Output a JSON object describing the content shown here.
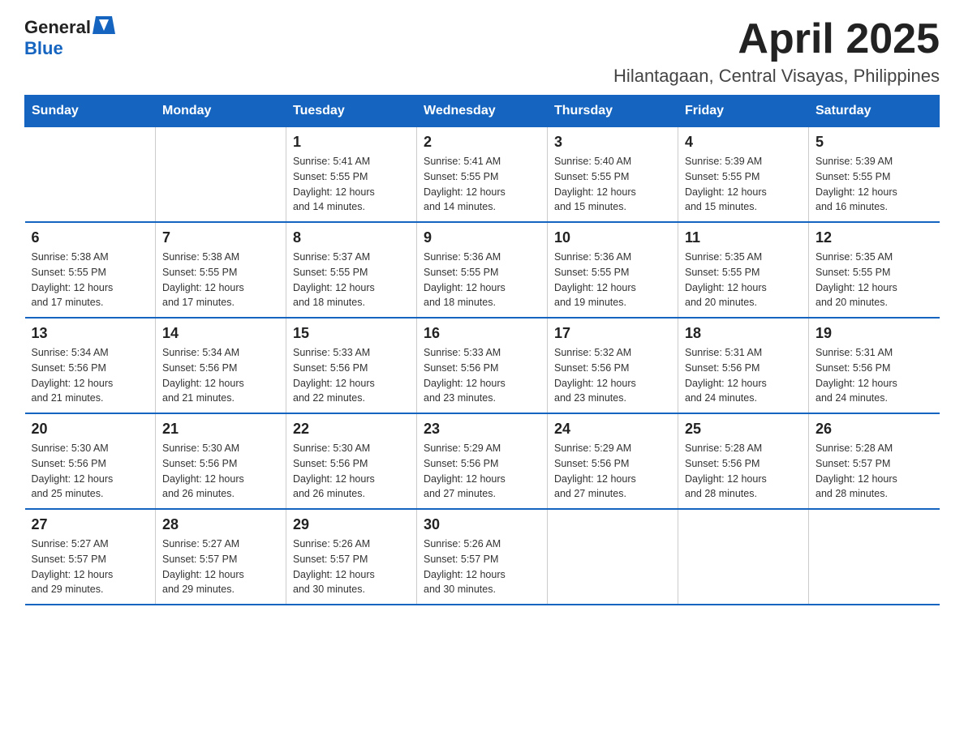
{
  "header": {
    "logo_general": "General",
    "logo_blue": "Blue",
    "title": "April 2025",
    "subtitle": "Hilantagaan, Central Visayas, Philippines"
  },
  "calendar": {
    "days_of_week": [
      "Sunday",
      "Monday",
      "Tuesday",
      "Wednesday",
      "Thursday",
      "Friday",
      "Saturday"
    ],
    "weeks": [
      [
        {
          "day": "",
          "info": ""
        },
        {
          "day": "",
          "info": ""
        },
        {
          "day": "1",
          "info": "Sunrise: 5:41 AM\nSunset: 5:55 PM\nDaylight: 12 hours\nand 14 minutes."
        },
        {
          "day": "2",
          "info": "Sunrise: 5:41 AM\nSunset: 5:55 PM\nDaylight: 12 hours\nand 14 minutes."
        },
        {
          "day": "3",
          "info": "Sunrise: 5:40 AM\nSunset: 5:55 PM\nDaylight: 12 hours\nand 15 minutes."
        },
        {
          "day": "4",
          "info": "Sunrise: 5:39 AM\nSunset: 5:55 PM\nDaylight: 12 hours\nand 15 minutes."
        },
        {
          "day": "5",
          "info": "Sunrise: 5:39 AM\nSunset: 5:55 PM\nDaylight: 12 hours\nand 16 minutes."
        }
      ],
      [
        {
          "day": "6",
          "info": "Sunrise: 5:38 AM\nSunset: 5:55 PM\nDaylight: 12 hours\nand 17 minutes."
        },
        {
          "day": "7",
          "info": "Sunrise: 5:38 AM\nSunset: 5:55 PM\nDaylight: 12 hours\nand 17 minutes."
        },
        {
          "day": "8",
          "info": "Sunrise: 5:37 AM\nSunset: 5:55 PM\nDaylight: 12 hours\nand 18 minutes."
        },
        {
          "day": "9",
          "info": "Sunrise: 5:36 AM\nSunset: 5:55 PM\nDaylight: 12 hours\nand 18 minutes."
        },
        {
          "day": "10",
          "info": "Sunrise: 5:36 AM\nSunset: 5:55 PM\nDaylight: 12 hours\nand 19 minutes."
        },
        {
          "day": "11",
          "info": "Sunrise: 5:35 AM\nSunset: 5:55 PM\nDaylight: 12 hours\nand 20 minutes."
        },
        {
          "day": "12",
          "info": "Sunrise: 5:35 AM\nSunset: 5:55 PM\nDaylight: 12 hours\nand 20 minutes."
        }
      ],
      [
        {
          "day": "13",
          "info": "Sunrise: 5:34 AM\nSunset: 5:56 PM\nDaylight: 12 hours\nand 21 minutes."
        },
        {
          "day": "14",
          "info": "Sunrise: 5:34 AM\nSunset: 5:56 PM\nDaylight: 12 hours\nand 21 minutes."
        },
        {
          "day": "15",
          "info": "Sunrise: 5:33 AM\nSunset: 5:56 PM\nDaylight: 12 hours\nand 22 minutes."
        },
        {
          "day": "16",
          "info": "Sunrise: 5:33 AM\nSunset: 5:56 PM\nDaylight: 12 hours\nand 23 minutes."
        },
        {
          "day": "17",
          "info": "Sunrise: 5:32 AM\nSunset: 5:56 PM\nDaylight: 12 hours\nand 23 minutes."
        },
        {
          "day": "18",
          "info": "Sunrise: 5:31 AM\nSunset: 5:56 PM\nDaylight: 12 hours\nand 24 minutes."
        },
        {
          "day": "19",
          "info": "Sunrise: 5:31 AM\nSunset: 5:56 PM\nDaylight: 12 hours\nand 24 minutes."
        }
      ],
      [
        {
          "day": "20",
          "info": "Sunrise: 5:30 AM\nSunset: 5:56 PM\nDaylight: 12 hours\nand 25 minutes."
        },
        {
          "day": "21",
          "info": "Sunrise: 5:30 AM\nSunset: 5:56 PM\nDaylight: 12 hours\nand 26 minutes."
        },
        {
          "day": "22",
          "info": "Sunrise: 5:30 AM\nSunset: 5:56 PM\nDaylight: 12 hours\nand 26 minutes."
        },
        {
          "day": "23",
          "info": "Sunrise: 5:29 AM\nSunset: 5:56 PM\nDaylight: 12 hours\nand 27 minutes."
        },
        {
          "day": "24",
          "info": "Sunrise: 5:29 AM\nSunset: 5:56 PM\nDaylight: 12 hours\nand 27 minutes."
        },
        {
          "day": "25",
          "info": "Sunrise: 5:28 AM\nSunset: 5:56 PM\nDaylight: 12 hours\nand 28 minutes."
        },
        {
          "day": "26",
          "info": "Sunrise: 5:28 AM\nSunset: 5:57 PM\nDaylight: 12 hours\nand 28 minutes."
        }
      ],
      [
        {
          "day": "27",
          "info": "Sunrise: 5:27 AM\nSunset: 5:57 PM\nDaylight: 12 hours\nand 29 minutes."
        },
        {
          "day": "28",
          "info": "Sunrise: 5:27 AM\nSunset: 5:57 PM\nDaylight: 12 hours\nand 29 minutes."
        },
        {
          "day": "29",
          "info": "Sunrise: 5:26 AM\nSunset: 5:57 PM\nDaylight: 12 hours\nand 30 minutes."
        },
        {
          "day": "30",
          "info": "Sunrise: 5:26 AM\nSunset: 5:57 PM\nDaylight: 12 hours\nand 30 minutes."
        },
        {
          "day": "",
          "info": ""
        },
        {
          "day": "",
          "info": ""
        },
        {
          "day": "",
          "info": ""
        }
      ]
    ]
  }
}
